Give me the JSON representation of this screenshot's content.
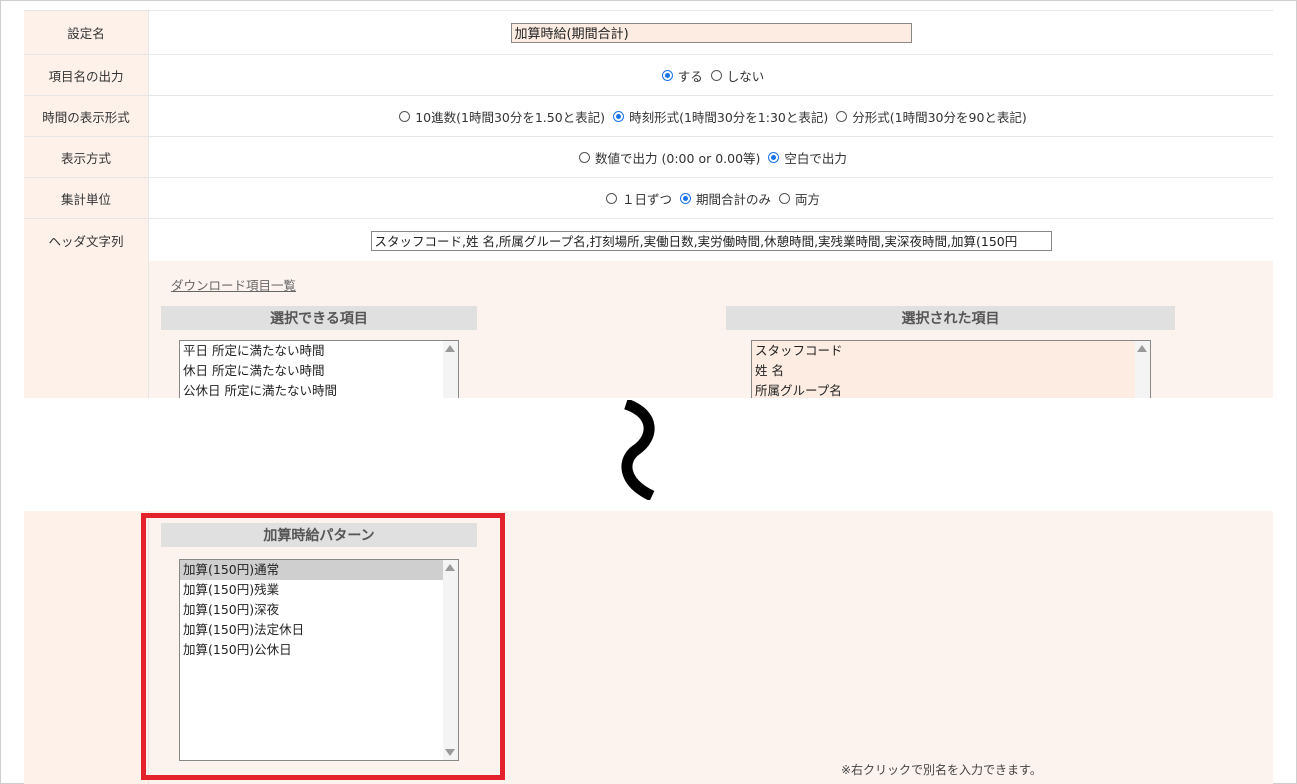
{
  "settings": {
    "name_label": "設定名",
    "name_value": "加算時給(期間合計)",
    "output_label": "項目名の出力",
    "output_options": [
      "する",
      "しない"
    ],
    "time_format_label": "時間の表示形式",
    "time_format_options": [
      "10進数(1時間30分を1.50と表記)",
      "時刻形式(1時間30分を1:30と表記)",
      "分形式(1時間30分を90と表記)"
    ],
    "display_label": "表示方式",
    "display_options": [
      "数値で出力 (0:00 or 0.00等)",
      "空白で出力"
    ],
    "unit_label": "集計単位",
    "unit_options": [
      "１日ずつ",
      "期間合計のみ",
      "両方"
    ],
    "header_label": "ヘッダ文字列",
    "header_value": "スタッフコード,姓 名,所属グループ名,打刻場所,実働日数,実労働時間,休憩時間,実残業時間,実深夜時間,加算(150円"
  },
  "download": {
    "link": "ダウンロード項目一覧",
    "available_title": "選択できる項目",
    "available_items": [
      "平日 所定に満たない時間",
      "休日 所定に満たない時間",
      "公休日 所定に満たない時間"
    ],
    "selected_title": "選択された項目",
    "selected_items": [
      "スタッフコード",
      "姓 名",
      "所属グループ名"
    ]
  },
  "pattern": {
    "title": "加算時給パターン",
    "items": [
      "加算(150円)通常",
      "加算(150円)残業",
      "加算(150円)深夜",
      "加算(150円)法定休日",
      "加算(150円)公休日"
    ]
  },
  "note": "※右クリックで別名を入力できます。",
  "colors": {
    "highlight": "#e3222b",
    "label_bg": "#fdf1ea",
    "radio_on": "#1a73e8"
  }
}
